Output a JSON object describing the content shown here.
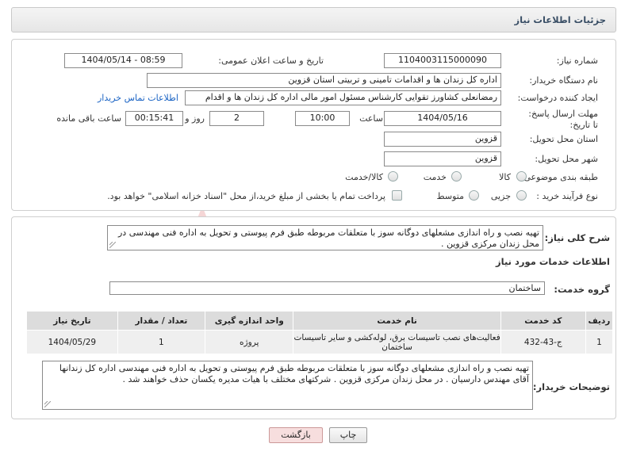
{
  "header": {
    "title": "جزئیات اطلاعات نیاز"
  },
  "form": {
    "need_number_label": "شماره نیاز:",
    "need_number": "1104003115000090",
    "announce_label": "تاریخ و ساعت اعلان عمومی:",
    "announce_value": "1404/05/14 - 08:59",
    "buyer_org_label": "نام دستگاه خریدار:",
    "buyer_org": "اداره کل زندان ها و اقدامات تامینی و تربیتی استان قزوین",
    "creator_label": "ایجاد کننده درخواست:",
    "creator": "رمضانعلی کشاورز تقوایی کارشناس مسئول امور مالی  اداره کل زندان ها و اقدام",
    "contact_link": "اطلاعات تماس خریدار",
    "deadline_label": "مهلت ارسال پاسخ: تا تاریخ:",
    "deadline_date": "1404/05/16",
    "time_label": "ساعت",
    "deadline_time": "10:00",
    "days_value": "2",
    "days_label": "روز و",
    "remaining_time": "00:15:41",
    "remaining_label": "ساعت باقی مانده",
    "province_label": "استان محل تحویل:",
    "province": "قزوین",
    "city_label": "شهر محل تحویل:",
    "city": "قزوین",
    "category_label": "طبقه بندی موضوعی:",
    "category_options": [
      "کالا",
      "خدمت",
      "کالا/خدمت"
    ],
    "category_selected": "خدمت",
    "process_label": "نوع فرآیند خرید :",
    "process_options": [
      "جزیی",
      "متوسط"
    ],
    "payment_note": "پرداخت تمام یا بخشی از مبلغ خرید،از محل \"اسناد خزانه اسلامی\" خواهد بود."
  },
  "description": {
    "label": "شرح کلی نیاز:",
    "text": "تهیه نصب و راه اندازی مشعلهای دوگانه سوز با متعلقات مربوطه طبق فرم پیوستی و تحویل به اداره فنی مهندسی در محل زندان مرکزی قزوین ."
  },
  "services": {
    "section_title": "اطلاعات خدمات مورد نیاز",
    "group_label": "گروه خدمت:",
    "group_value": "ساختمان",
    "columns": [
      "ردیف",
      "کد خدمت",
      "نام خدمت",
      "واحد اندازه گیری",
      "تعداد / مقدار",
      "تاریخ نیاز"
    ],
    "rows": [
      {
        "row": "1",
        "code": "ج-43-432",
        "name": "فعالیت‌های نصب تاسیسات برق، لوله‌کشی و سایر تاسیسات ساختمان",
        "unit": "پروژه",
        "qty": "1",
        "date": "1404/05/29"
      }
    ]
  },
  "buyer_notes": {
    "label": "توضیحات خریدار:",
    "text": "تهیه نصب و راه اندازی مشعلهای دوگانه سوز با متعلقات مربوطه طبق فرم پیوستی و تحویل به اداره فنی مهندسی اداره کل زندانها آقای مهندس دارسیان . در محل زندان مرکزی قزوین . شرکتهای مختلف با هیات مدیره یکسان حذف خواهند شد ."
  },
  "buttons": {
    "print": "چاپ",
    "back": "بازگشت"
  },
  "colors": {
    "watermark": "#f3c9c9",
    "link": "#1a63c4",
    "back_button": "#f7dede"
  }
}
